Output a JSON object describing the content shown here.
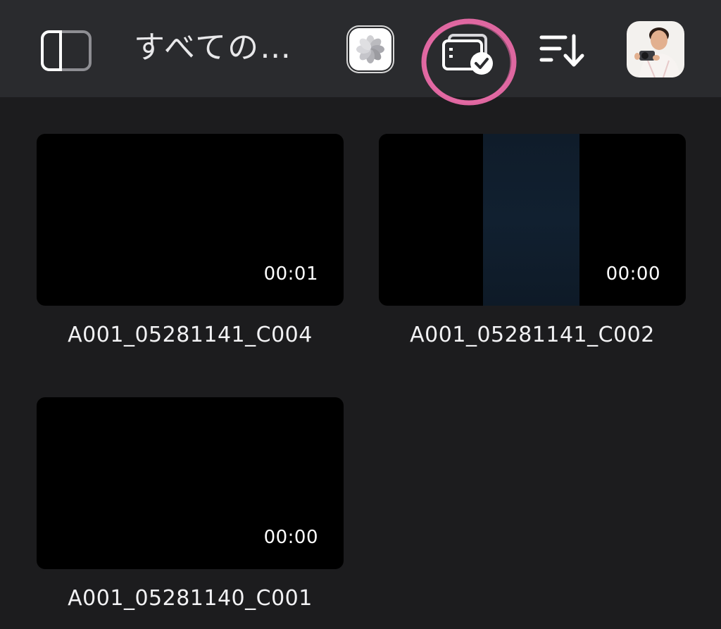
{
  "toolbar": {
    "title": "すべての…",
    "icons": {
      "sidebar_toggle": "sidebar-toggle-icon",
      "photos": "photos-app-icon",
      "select": "select-clips-icon",
      "sort": "sort-descending-icon",
      "avatar": "user-avatar"
    },
    "highlight_color": "#e86aa6"
  },
  "clips": [
    {
      "name": "A001_05281141_C004",
      "duration": "00:01"
    },
    {
      "name": "A001_05281141_C002",
      "duration": "00:00"
    },
    {
      "name": "A001_05281140_C001",
      "duration": "00:00"
    }
  ],
  "colors": {
    "background": "#1c1c1e",
    "toolbar": "#2a2b2e",
    "thumbnail": "#000000",
    "text": "#ffffff"
  }
}
